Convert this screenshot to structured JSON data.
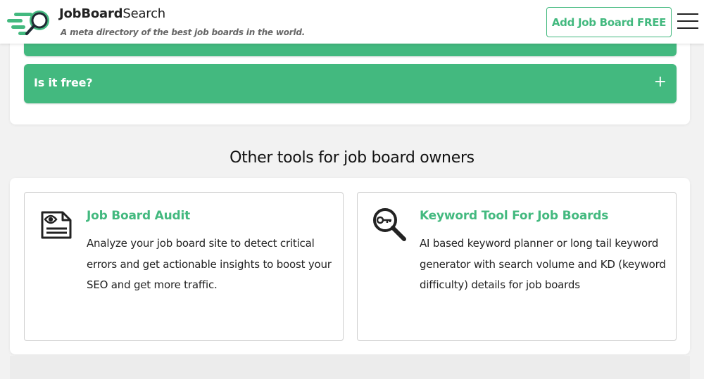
{
  "header": {
    "brand_bold": "JobBoard",
    "brand_light": "Search",
    "tagline": "A meta directory of the best job boards in the world.",
    "add_button_label": "Add Job Board FREE",
    "menu_icon": "hamburger-menu-icon"
  },
  "faq": {
    "question": "Is it free?",
    "expand_symbol": "+"
  },
  "tools_section": {
    "title": "Other tools for job board owners",
    "tools": [
      {
        "icon": "audit-icon",
        "title": "Job Board Audit",
        "description": "Analyze your job board site to detect critical errors and get actionable insights to boost your SEO and get more traffic."
      },
      {
        "icon": "keyword-search-icon",
        "title": "Keyword Tool For Job Boards",
        "description": "AI based keyword planner or long tail keyword generator with search volume and KD (keyword difficulty) details for job boards"
      }
    ]
  },
  "colors": {
    "brand_green": "#43b97f",
    "background": "#f2f2f2",
    "card": "#ffffff",
    "text": "#222222"
  }
}
